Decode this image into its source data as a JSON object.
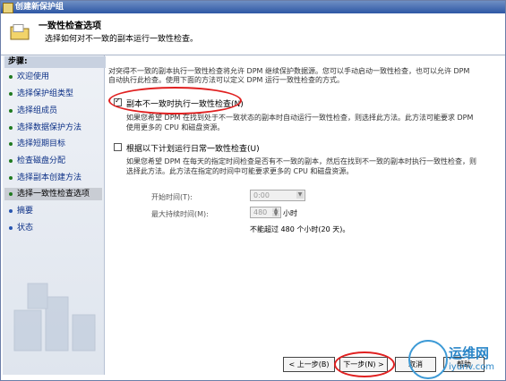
{
  "window": {
    "title": "创建新保护组"
  },
  "header": {
    "title": "一致性检查选项",
    "subtitle": "选择如何对不一致的副本运行一致性检查。"
  },
  "sidebar": {
    "heading": "步骤:",
    "items": [
      {
        "label": "欢迎使用",
        "state": "done"
      },
      {
        "label": "选择保护组类型",
        "state": "done"
      },
      {
        "label": "选择组成员",
        "state": "done"
      },
      {
        "label": "选择数据保护方法",
        "state": "done"
      },
      {
        "label": "选择短期目标",
        "state": "done"
      },
      {
        "label": "检查磁盘分配",
        "state": "done"
      },
      {
        "label": "选择副本创建方法",
        "state": "done"
      },
      {
        "label": "选择一致性检查选项",
        "state": "current"
      },
      {
        "label": "摘要",
        "state": "pending"
      },
      {
        "label": "状态",
        "state": "pending"
      }
    ]
  },
  "main": {
    "intro_line1": "对突得不一致的副本执行一致性检查将允许 DPM 继续保护数据源。您可以手动启动一致性检查，也可以允许 DPM",
    "intro_line2": "自动执行此检查。使用下面的方法可以定义 DPM 运行一致性检查的方式。",
    "option1": {
      "label": "副本不一致时执行一致性检查(N)",
      "checked": true,
      "desc_line1": "如果您希望 DPM 在找到处于不一致状态的副本时自动运行一致性检查，则选择此方法。此方法可能要求 DPM",
      "desc_line2": "使用更多的 CPU 和磁盘资源。"
    },
    "option2": {
      "label": "根据以下计划运行日常一致性检查(U)",
      "checked": false,
      "desc_line1": "如果您希望 DPM 在每天的指定时间检查是否有不一致的副本，然后在找到不一致的副本时执行一致性检查，则",
      "desc_line2": "选择此方法。此方法在指定的时间中可能要求更多的 CPU 和磁盘资源。"
    },
    "start_time": {
      "label": "开始时间(T):",
      "value": "0:00"
    },
    "max_duration": {
      "label": "最大持续时间(M):",
      "value": "480",
      "unit": "小时"
    },
    "note": "不能超过 480 个小时(20 天)。"
  },
  "buttons": {
    "back": "< 上一步(B)",
    "next": "下一步(N) >",
    "cancel": "取消",
    "help": "帮助"
  },
  "watermark": {
    "line1": "运维网",
    "line2": "iyunv.com"
  },
  "colors": {
    "annotation": "#e02020",
    "title_bar": "#2e57a4"
  }
}
